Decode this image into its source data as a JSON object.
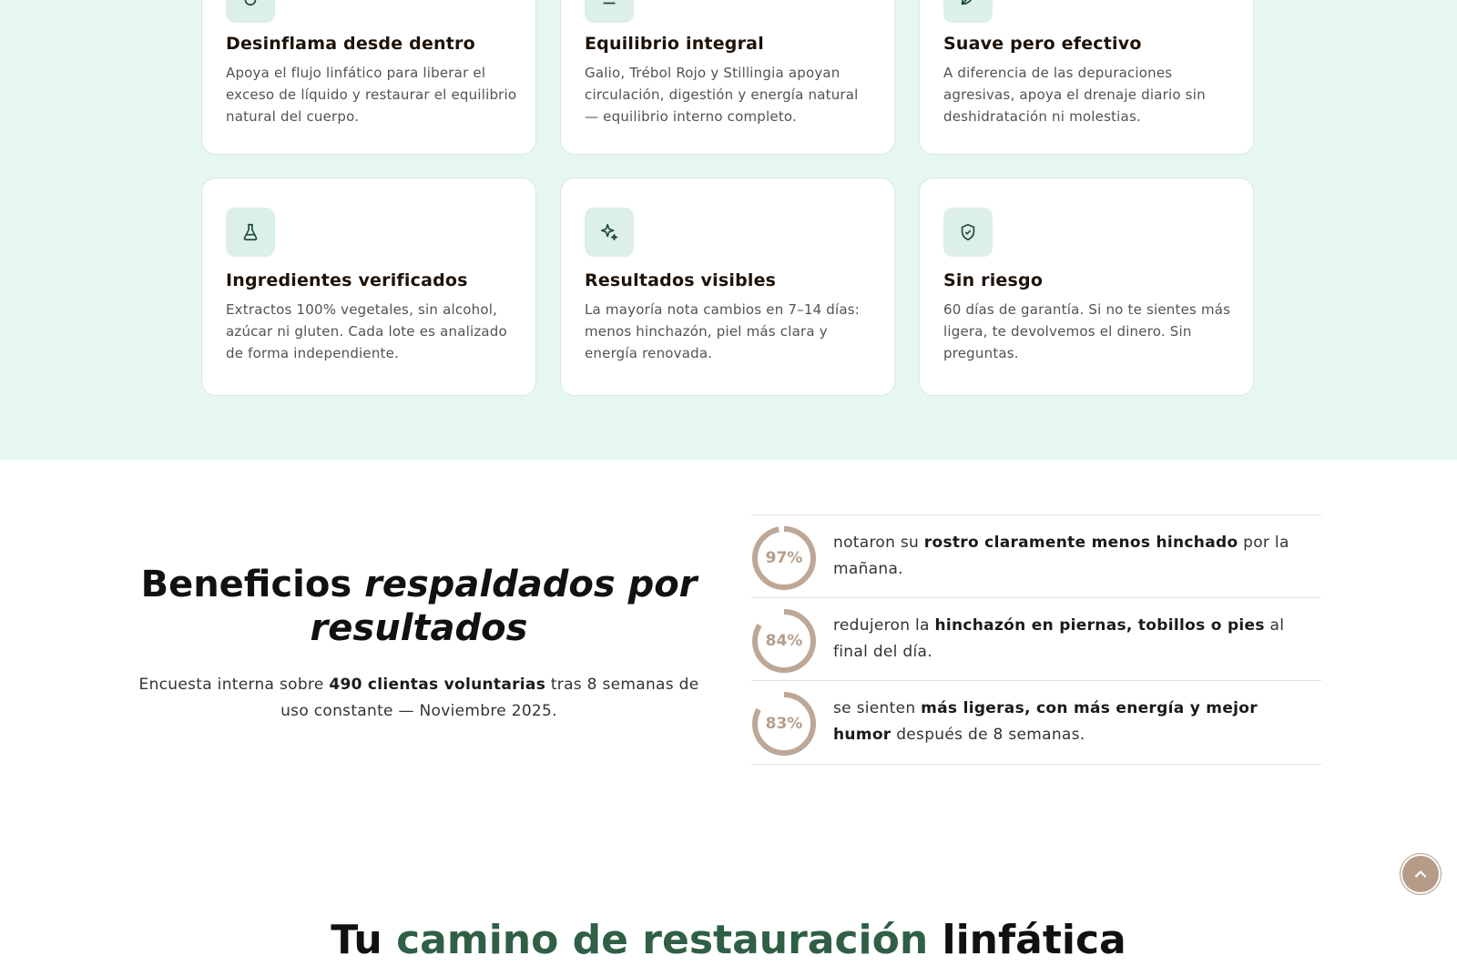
{
  "colors": {
    "features_bg": "#e6f6f3",
    "icon_bg": "#dcefe9",
    "icon_stroke": "#1f4a36",
    "ring": "#bda796",
    "accent_green": "#2f5f45",
    "scroll_button": "#b69c88"
  },
  "features": [
    {
      "icon": "drop-icon",
      "title": "Desinflama desde dentro",
      "desc": "Apoya el flujo linfático para liberar el exceso de líquido y restaurar el equilibrio natural del cuerpo."
    },
    {
      "icon": "balance-icon",
      "title": "Equilibrio integral",
      "desc": "Galio, Trébol Rojo y Stillingia apoyan circulación, digestión y energía natural — equilibrio interno completo."
    },
    {
      "icon": "leaf-icon",
      "title": "Suave pero efectivo",
      "desc": "A diferencia de las depuraciones agresivas, apoya el drenaje diario sin deshidratación ni molestias."
    },
    {
      "icon": "flask-icon",
      "title": "Ingredientes verificados",
      "desc": "Extractos 100% vegetales, sin alcohol, azúcar ni gluten. Cada lote es analizado de forma independiente."
    },
    {
      "icon": "sparkles-icon",
      "title": "Resultados visibles",
      "desc": "La mayoría nota cambios en 7–14 días: menos hinchazón, piel más clara y energía renovada."
    },
    {
      "icon": "shield-check-icon",
      "title": "Sin riesgo",
      "desc": "60 días de garantía. Si no te sientes más ligera, te devolvemos el dinero. Sin preguntas."
    }
  ],
  "benefits": {
    "heading_plain": "Beneficios ",
    "heading_italic": "respaldados por resultados",
    "intro_pre": "Encuesta interna sobre ",
    "intro_bold": "490 clientas voluntarias",
    "intro_post": " tras 8 semanas de uso constante — Noviembre 2025."
  },
  "stats": [
    {
      "value": 97,
      "label": "97%",
      "pre": "notaron su ",
      "bold": "rostro claramente menos hinchado",
      "post": " por la mañana."
    },
    {
      "value": 84,
      "label": "84%",
      "pre": "redujeron la ",
      "bold": "hinchazón en piernas, tobillos o pies",
      "post": " al final del día."
    },
    {
      "value": 83,
      "label": "83%",
      "pre": "se sienten ",
      "bold": "más ligeras, con más energía y mejor humor",
      "post": " después de 8 semanas."
    }
  ],
  "next_section": {
    "pre": "Tu ",
    "accent": "camino de restauración",
    "post": " linfática"
  },
  "scroll_top_icon": "chevron-up-icon"
}
